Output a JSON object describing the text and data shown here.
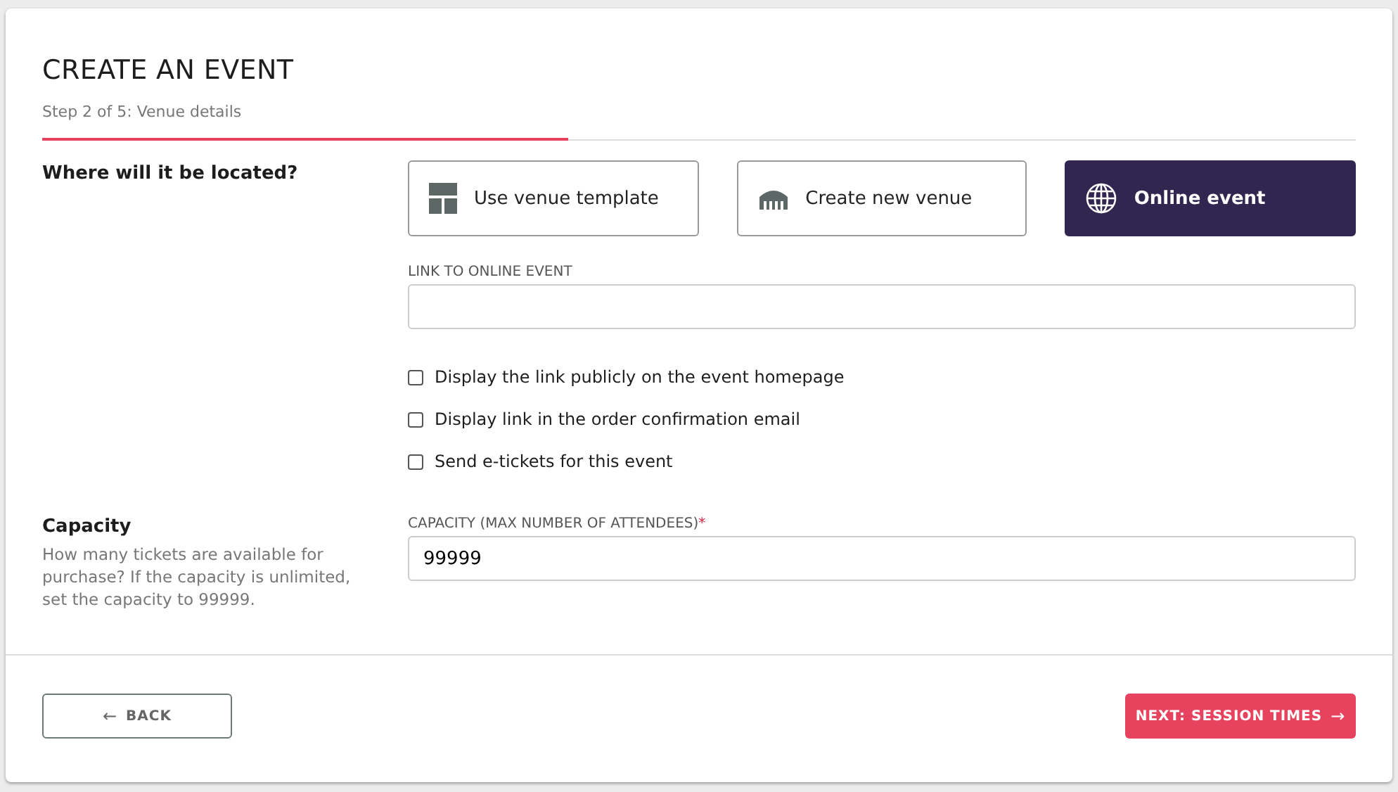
{
  "header": {
    "title": "CREATE AN EVENT",
    "subtitle": "Step 2 of 5: Venue details",
    "progress": {
      "level": 0.4
    }
  },
  "location": {
    "label": "Where will it be located?",
    "options": [
      {
        "kind": "template",
        "label": "Use venue template",
        "selected": false
      },
      {
        "kind": "venue",
        "label": "Create new venue",
        "selected": false
      },
      {
        "kind": "online",
        "label": "Online event",
        "selected": true
      }
    ],
    "link_field": {
      "label": "LINK TO ONLINE EVENT"
    },
    "checkboxes": [
      {
        "label": "Display the link publicly on the event homepage",
        "checked": false
      },
      {
        "label": "Display link in the order confirmation email",
        "checked": false
      },
      {
        "label": "Send e-tickets for this event",
        "checked": false
      }
    ]
  },
  "capacity": {
    "label": "Capacity",
    "description": "How many tickets are available for purchase? If the capacity is unlimited, set the capacity to 99999.",
    "field_label": "CAPACITY (MAX NUMBER OF ATTENDEES)",
    "required_mark": "*",
    "value": "99999"
  },
  "footer": {
    "back": {
      "arrow": "←",
      "label": "BACK"
    },
    "next": {
      "label": "NEXT: SESSION TIMES",
      "arrow": "→"
    }
  }
}
